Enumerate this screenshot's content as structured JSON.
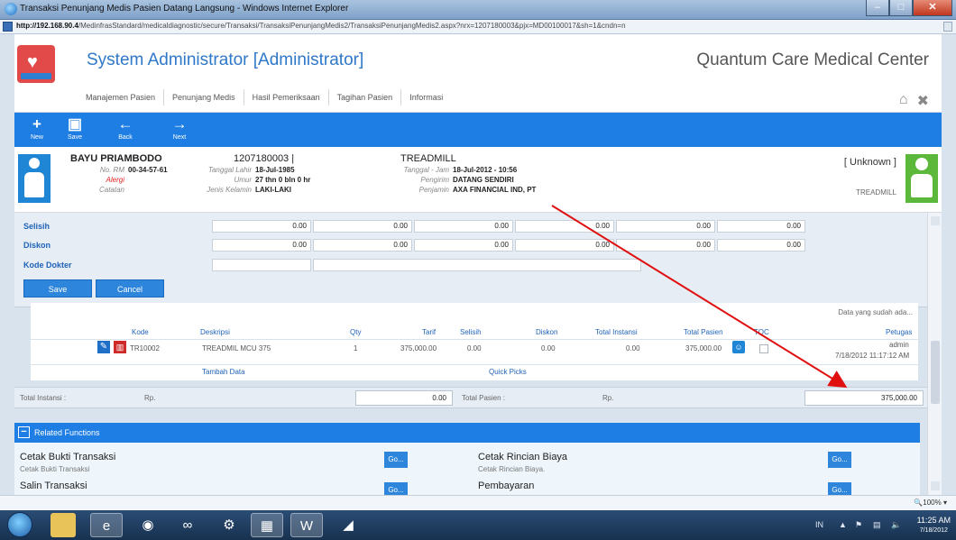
{
  "window": {
    "title": "Transaksi Penunjang Medis Pasien Datang Langsung - Windows Internet Explorer",
    "url_host": "http://192.168.90.4",
    "url_path": "/MedinfrasStandard/medicaldiagnostic/secure/Transaksi/TransaksiPenunjangMedis2/TransaksiPenunjangMedis2.aspx?nrx=1207180003&pjx=MD00100017&sh=1&cndn=n"
  },
  "header": {
    "app_title": "System Administrator [Administrator]",
    "org_name": "Quantum Care Medical Center",
    "nav": [
      "Manajemen Pasien",
      "Penunjang Medis",
      "Hasil Pemeriksaan",
      "Tagihan Pasien",
      "Informasi"
    ]
  },
  "toolbar": {
    "new": "New",
    "save": "Save",
    "back": "Back",
    "next": "Next"
  },
  "patient": {
    "name": "BAYU PRIAMBODO",
    "rm_label": "No. RM",
    "rm_value": "00-34-57-61",
    "allergy_label": "Alergi",
    "notes_label": "Catatan",
    "reg_no": "1207180003 |",
    "dob_label": "Tanggal Lahir",
    "dob_value": "18-Jul-1985",
    "age_label": "Umur",
    "age_value": "27 thn 0 bln 0 hr",
    "sex_label": "Jenis Kelamin",
    "sex_value": "LAKI-LAKI",
    "service": "TREADMILL",
    "datetime_label": "Tanggal - Jam",
    "datetime_value": "18-Jul-2012 - 10:56",
    "sender_label": "Pengirim",
    "sender_value": "DATANG SENDIRI",
    "guarantor_label": "Penjamin",
    "guarantor_value": "AXA FINANCIAL IND, PT",
    "doctor_status": "[ Unknown ]",
    "doctor_service": "TREADMILL"
  },
  "form": {
    "selisih_label": "Selisih",
    "diskon_label": "Diskon",
    "kode_dokter_label": "Kode Dokter",
    "zero": "0.00",
    "save_btn": "Save",
    "cancel_btn": "Cancel"
  },
  "grid": {
    "data_hint": "Data yang sudah ada...",
    "headers": [
      "Kode",
      "Deskripsi",
      "Qty",
      "Tarif",
      "Selisih",
      "Diskon",
      "Total Instansi",
      "Total Pasien",
      "TOC",
      "Petugas"
    ],
    "row": {
      "kode": "TR10002",
      "deskripsi": "TREADMIL MCU 375",
      "qty": "1",
      "tarif": "375,000.00",
      "selisih": "0.00",
      "diskon": "0.00",
      "total_instansi": "0.00",
      "total_pasien": "375,000.00",
      "petugas_name": "admin",
      "petugas_time": "7/18/2012 11:17:12 AM"
    },
    "tambah_data": "Tambah Data",
    "quick_picks": "Quick Picks"
  },
  "totals": {
    "instansi_label": "Total Instansi :",
    "currency": "Rp.",
    "instansi_value": "0.00",
    "pasien_label": "Total Pasien :",
    "pasien_value": "375,000.00"
  },
  "related": {
    "title": "Related Functions",
    "items": [
      {
        "title": "Cetak Bukti Transaksi",
        "sub": "Cetak Bukti Transaksi"
      },
      {
        "title": "Cetak Rincian Biaya",
        "sub": "Cetak Rincian Biaya."
      },
      {
        "title": "Salin Transaksi",
        "sub": ""
      },
      {
        "title": "Pembayaran",
        "sub": ""
      }
    ],
    "go": "Go..."
  },
  "statusbar": {
    "zoom": "100%"
  },
  "taskbar": {
    "lang": "IN",
    "time": "11:25 AM",
    "date": "7/18/2012"
  },
  "colors": {
    "accent": "#1e7ee4",
    "annotation": "#e01010",
    "alert": "#d22222"
  }
}
